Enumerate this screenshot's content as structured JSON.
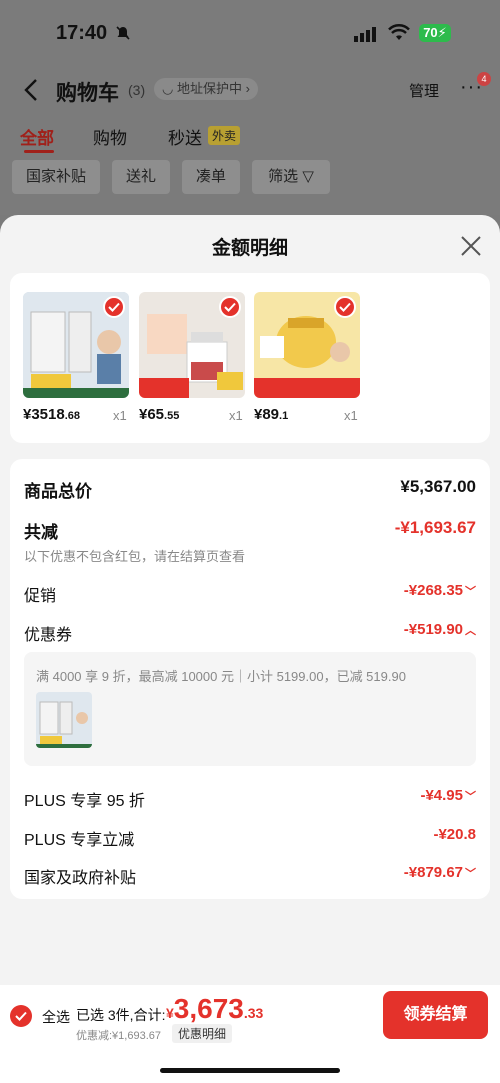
{
  "status": {
    "time": "17:40",
    "battery": "70"
  },
  "nav": {
    "title": "购物车",
    "count": "(3)",
    "address": "地址保护中",
    "manage": "管理",
    "more_badge": "4"
  },
  "tabs": [
    {
      "label": "全部"
    },
    {
      "label": "购物"
    },
    {
      "label": "秒送"
    }
  ],
  "tab_badge": "外卖",
  "filters": [
    "国家补贴",
    "送礼",
    "凑单",
    "筛选"
  ],
  "sheet": {
    "title": "金额明细",
    "products": [
      {
        "price_int": "¥3518",
        "price_dec": ".68",
        "qty": "x1",
        "color": "#c9d6e3"
      },
      {
        "price_int": "¥65",
        "price_dec": ".55",
        "qty": "x1",
        "color": "#e8e4df"
      },
      {
        "price_int": "¥89",
        "price_dec": ".1",
        "qty": "x1",
        "color": "#f5d96a"
      }
    ],
    "summary": {
      "total_label": "商品总价",
      "total_value": "¥5,367.00",
      "reduce_label": "共减",
      "reduce_value": "-¥1,693.67",
      "reduce_note": "以下优惠不包含红包，请在结算页查看",
      "promo_label": "促销",
      "promo_value": "-¥268.35",
      "coupon_label": "优惠券",
      "coupon_value": "-¥519.90",
      "coupon_detail": "满 4000 享 9 折，最高减 10000 元｜小计 5199.00，已减 519.90",
      "plus95_label": "PLUS 专享 95 折",
      "plus95_value": "-¥4.95",
      "plusdirect_label": "PLUS 专享立减",
      "plusdirect_value": "-¥20.8",
      "subsidy_label": "国家及政府补贴",
      "subsidy_value": "-¥879.67"
    }
  },
  "bottom": {
    "select_all": "全选",
    "selected": "已选 3件,合计:",
    "total_yen": "¥",
    "total_int": "3,673",
    "total_dec": ".33",
    "discount": "优惠减:¥1,693.67",
    "detail_btn": "优惠明细",
    "pay_btn": "领券结算"
  }
}
